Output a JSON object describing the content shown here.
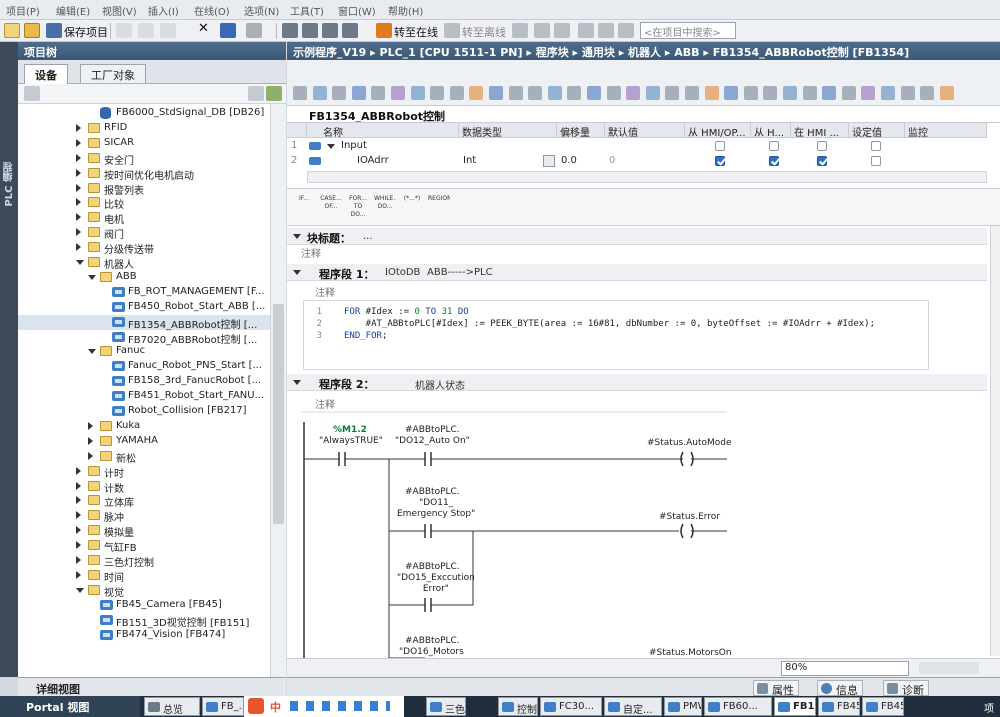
{
  "menu": [
    "项目(P)",
    "编辑(E)",
    "视图(V)",
    "插入(I)",
    "在线(O)",
    "选项(N)",
    "工具(T)",
    "窗口(W)",
    "帮助(H)"
  ],
  "toolbar": {
    "save_label": "保存项目",
    "go_online": "转至在线",
    "go_offline": "转至离线",
    "search_placeholder": "<在项目中搜索>"
  },
  "side_strip": "PLC 编程",
  "tree": {
    "title": "项目树",
    "tabs": [
      "设备",
      "工厂对象"
    ],
    "items": [
      {
        "label": "FB6000_StdSignal_DB [DB26]",
        "indent": 4,
        "kind": "db",
        "expander": "none"
      },
      {
        "label": "RFID",
        "indent": 3,
        "kind": "folder",
        "expander": "closed"
      },
      {
        "label": "SICAR",
        "indent": 3,
        "kind": "folder",
        "expander": "closed"
      },
      {
        "label": "安全门",
        "indent": 3,
        "kind": "folder",
        "expander": "closed"
      },
      {
        "label": "按时间优化电机启动",
        "indent": 3,
        "kind": "folder",
        "expander": "closed"
      },
      {
        "label": "报警列表",
        "indent": 3,
        "kind": "folder",
        "expander": "closed"
      },
      {
        "label": "比较",
        "indent": 3,
        "kind": "folder",
        "expander": "closed"
      },
      {
        "label": "电机",
        "indent": 3,
        "kind": "folder",
        "expander": "closed"
      },
      {
        "label": "阀门",
        "indent": 3,
        "kind": "folder",
        "expander": "closed"
      },
      {
        "label": "分级传送带",
        "indent": 3,
        "kind": "folder",
        "expander": "closed"
      },
      {
        "label": "机器人",
        "indent": 3,
        "kind": "folder",
        "expander": "open"
      },
      {
        "label": "ABB",
        "indent": 4,
        "kind": "folder",
        "expander": "open"
      },
      {
        "label": "FB_ROT_MANAGEMENT [F...",
        "indent": 5,
        "kind": "block",
        "expander": "none"
      },
      {
        "label": "FB450_Robot_Start_ABB [...",
        "indent": 5,
        "kind": "block",
        "expander": "none"
      },
      {
        "label": "FB1354_ABBRobot控制 [...",
        "indent": 5,
        "kind": "block",
        "expander": "none",
        "selected": true
      },
      {
        "label": "FB7020_ABBRobot控制 [...",
        "indent": 5,
        "kind": "block",
        "expander": "none"
      },
      {
        "label": "Fanuc",
        "indent": 4,
        "kind": "folder",
        "expander": "open"
      },
      {
        "label": "Fanuc_Robot_PNS_Start [...",
        "indent": 5,
        "kind": "block",
        "expander": "none"
      },
      {
        "label": "FB158_3rd_FanucRobot [...",
        "indent": 5,
        "kind": "block",
        "expander": "none"
      },
      {
        "label": "FB451_Robot_Start_FANU...",
        "indent": 5,
        "kind": "block",
        "expander": "none"
      },
      {
        "label": "Robot_Collision [FB217]",
        "indent": 5,
        "kind": "block",
        "expander": "none"
      },
      {
        "label": "Kuka",
        "indent": 4,
        "kind": "folder",
        "expander": "closed"
      },
      {
        "label": "YAMAHA",
        "indent": 4,
        "kind": "folder",
        "expander": "closed"
      },
      {
        "label": "新松",
        "indent": 4,
        "kind": "folder",
        "expander": "closed"
      },
      {
        "label": "计时",
        "indent": 3,
        "kind": "folder",
        "expander": "closed"
      },
      {
        "label": "计数",
        "indent": 3,
        "kind": "folder",
        "expander": "closed"
      },
      {
        "label": "立体库",
        "indent": 3,
        "kind": "folder",
        "expander": "closed"
      },
      {
        "label": "脉冲",
        "indent": 3,
        "kind": "folder",
        "expander": "closed"
      },
      {
        "label": "模拟量",
        "indent": 3,
        "kind": "folder",
        "expander": "closed"
      },
      {
        "label": "气缸FB",
        "indent": 3,
        "kind": "folder",
        "expander": "closed"
      },
      {
        "label": "三色灯控制",
        "indent": 3,
        "kind": "folder",
        "expander": "closed"
      },
      {
        "label": "时间",
        "indent": 3,
        "kind": "folder",
        "expander": "closed"
      },
      {
        "label": "视觉",
        "indent": 3,
        "kind": "folder",
        "expander": "open"
      },
      {
        "label": "FB45_Camera [FB45]",
        "indent": 4,
        "kind": "block",
        "expander": "none"
      },
      {
        "label": "FB151_3D视觉控制 [FB151]",
        "indent": 4,
        "kind": "block",
        "expander": "none"
      },
      {
        "label": "FB474_Vision [FB474]",
        "indent": 4,
        "kind": "block",
        "expander": "none"
      }
    ]
  },
  "editor": {
    "breadcrumb": "示例程序_V19 ▸ PLC_1 [CPU 1511-1 PN] ▸ 程序块 ▸ 通用块 ▸ 机器人 ▸ ABB ▸ FB1354_ABBRobot控制 [FB1354]",
    "block_title": "FB1354_ABBRobot控制",
    "interface": {
      "columns": [
        "名称",
        "数据类型",
        "偏移量",
        "默认值",
        "从 HMI/OP...",
        "从 H...",
        "在 HMI ...",
        "设定值",
        "监控"
      ],
      "rows": [
        {
          "num": "1",
          "name": "Input",
          "type": "",
          "offset": "",
          "default": "",
          "hmi1": false,
          "hmi2": false,
          "hmi3": false,
          "setpoint": false
        },
        {
          "num": "2",
          "name": "IOAdrr",
          "type": "Int",
          "offset": "0.0",
          "default": "0",
          "hmi1": true,
          "hmi2": true,
          "hmi3": true,
          "setpoint": false
        }
      ]
    },
    "palette": [
      "IF...",
      "CASE... OF...",
      "FOR... TO DO...",
      "WHILE... DO...",
      "(*...*)",
      "REGION"
    ],
    "block_header": {
      "title": "块标题：",
      "note": "...",
      "comment": "注释"
    },
    "networks": [
      {
        "title": "程序段 1：",
        "name": "IOtoDB",
        "subtitle": "ABB----->PLC",
        "comment": "注释"
      },
      {
        "title": "程序段 2：",
        "name": "机器人状态",
        "subtitle": "",
        "comment": "注释"
      }
    ],
    "scl": [
      {
        "line": "1",
        "parts": [
          [
            "kw",
            "FOR"
          ],
          [
            "t",
            " #Idex := "
          ],
          [
            "num",
            "0"
          ],
          [
            "kw",
            " TO "
          ],
          [
            "num",
            "31"
          ],
          [
            "kw",
            " DO"
          ]
        ]
      },
      {
        "line": "2",
        "parts": [
          [
            "t",
            "    #AT_ABBtoPLC[#Idex] := PEEK_BYTE(area := 16#81, dbNumber := 0, byteOffset := #IOAdrr + #Idex);"
          ]
        ]
      },
      {
        "line": "3",
        "parts": [
          [
            "kw",
            "END_FOR"
          ],
          [
            "t",
            ";"
          ]
        ]
      }
    ],
    "ladder": {
      "contact_m": {
        "addr": "%M1.2",
        "name": "\"AlwaysTRUE\""
      },
      "contacts": [
        {
          "tag": "#ABBtoPLC.",
          "name": "\"DO12_Auto On\""
        },
        {
          "tag": "#ABBtoPLC.",
          "name": "\"DO11_\nEmergency Stop\""
        },
        {
          "tag": "#ABBtoPLC.",
          "name": "\"DO15_Exccution\nError\""
        },
        {
          "tag": "#ABBtoPLC.",
          "name": "\"DO16_Motors"
        }
      ],
      "coils": [
        "#Status.AutoMode",
        "#Status.Error",
        "#Status.MotorsOn"
      ]
    },
    "zoom": "80%"
  },
  "detail_view": "详细视图",
  "props_tabs": [
    "属性",
    "信息",
    "诊断"
  ],
  "taskbar": {
    "portal": "Portal 视图",
    "overview": "总览",
    "tasks": [
      "FB_...",
      "三色...",
      "控制...",
      "FC30...",
      "自定...",
      "PMW...",
      "FB60...",
      "FB13...",
      "FB45...",
      "FB45..."
    ],
    "ime_label": "中",
    "tray_text": "项"
  }
}
